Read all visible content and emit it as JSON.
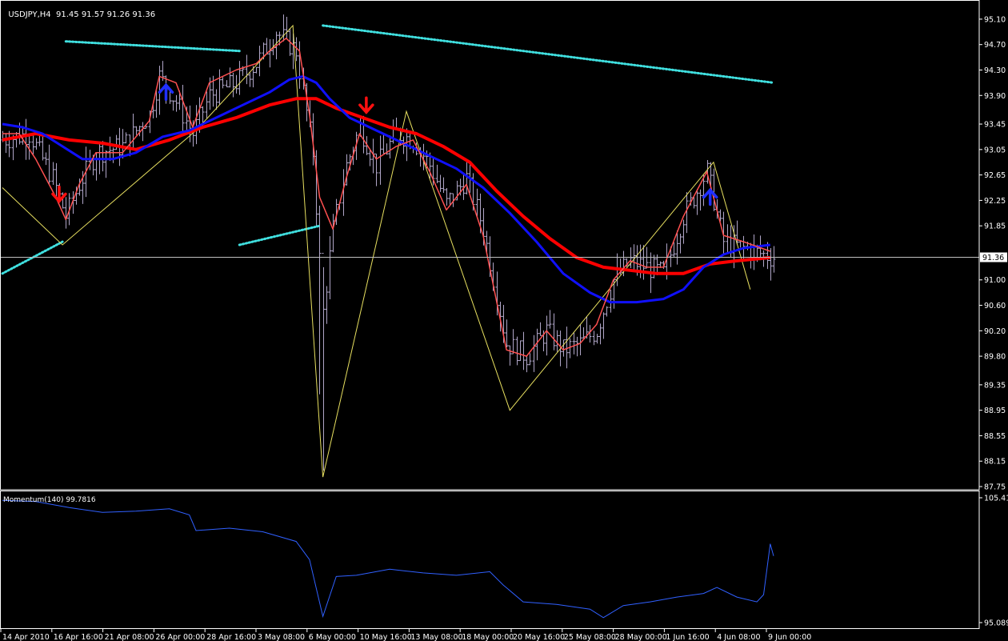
{
  "header": {
    "symbol": "USDJPY,H4",
    "ohlc": "91.45 91.57 91.26 91.36"
  },
  "indicator": {
    "label": "Momentum(140) 99.7816"
  },
  "colors": {
    "background": "#000000",
    "grid_axis": "#ffffff",
    "bar": "#b0a6c8",
    "ma_fast": "#ff5050",
    "ma_medium": "#1010ff",
    "ma_slow": "#ff0000",
    "zigzag": "#e8e060",
    "trend_dots": "#40e0e0",
    "arrow_up": "#2030ff",
    "arrow_down": "#ff1010",
    "momentum": "#3060ff",
    "price_tag_bg": "#ffffff",
    "price_tag_text": "#000000"
  },
  "chart_data": [
    {
      "type": "line",
      "title": "",
      "y_ticks": [
        "95.10",
        "94.70",
        "94.30",
        "93.90",
        "93.45",
        "93.05",
        "92.65",
        "92.25",
        "91.85",
        "91.00",
        "90.60",
        "90.20",
        "89.80",
        "89.35",
        "88.95",
        "88.55",
        "88.15",
        "87.75"
      ],
      "current_price_label": "91.36",
      "ylim": [
        87.7,
        95.25
      ],
      "x_ticks": [
        "14 Apr 2010",
        "16 Apr 16:00",
        "21 Apr 08:00",
        "26 Apr 00:00",
        "28 Apr 16:00",
        "3 May 08:00",
        "6 May 00:00",
        "10 May 16:00",
        "13 May 08:00",
        "18 May 00:00",
        "20 May 16:00",
        "25 May 08:00",
        "28 May 00:00",
        "1 Jun 16:00",
        "4 Jun 08:00",
        "9 Jun 00:00"
      ],
      "bar_count": 232,
      "series": [
        {
          "key": "close",
          "values": [
            [
              0,
              93.2
            ],
            [
              8,
              93.3
            ],
            [
              15,
              92.6
            ],
            [
              19,
              92.0
            ],
            [
              23,
              92.5
            ],
            [
              28,
              93.0
            ],
            [
              36,
              93.1
            ],
            [
              44,
              93.6
            ],
            [
              47,
              94.2
            ],
            [
              52,
              93.8
            ],
            [
              57,
              93.3
            ],
            [
              62,
              93.9
            ],
            [
              70,
              94.1
            ],
            [
              76,
              94.4
            ],
            [
              82,
              94.9
            ],
            [
              88,
              94.6
            ],
            [
              93,
              93.0
            ],
            [
              96,
              90.5
            ],
            [
              99,
              91.8
            ],
            [
              103,
              92.8
            ],
            [
              107,
              93.4
            ],
            [
              112,
              92.8
            ],
            [
              118,
              93.3
            ],
            [
              123,
              93.2
            ],
            [
              128,
              92.8
            ],
            [
              133,
              92.2
            ],
            [
              139,
              92.6
            ],
            [
              144,
              91.8
            ],
            [
              151,
              90.0
            ],
            [
              157,
              89.8
            ],
            [
              163,
              90.2
            ],
            [
              168,
              89.9
            ],
            [
              173,
              90.0
            ],
            [
              178,
              90.2
            ],
            [
              183,
              91.0
            ],
            [
              188,
              91.3
            ],
            [
              193,
              91.2
            ],
            [
              198,
              91.1
            ],
            [
              204,
              92.0
            ],
            [
              211,
              92.7
            ],
            [
              216,
              91.6
            ],
            [
              222,
              91.5
            ],
            [
              230,
              91.36
            ]
          ]
        },
        {
          "key": "ma_fast",
          "values": [
            [
              0,
              93.3
            ],
            [
              5,
              93.3
            ],
            [
              10,
              92.9
            ],
            [
              16,
              92.3
            ],
            [
              19,
              91.95
            ],
            [
              23,
              92.5
            ],
            [
              28,
              93.0
            ],
            [
              36,
              93.0
            ],
            [
              44,
              93.5
            ],
            [
              47,
              94.2
            ],
            [
              52,
              94.1
            ],
            [
              57,
              93.4
            ],
            [
              62,
              94.1
            ],
            [
              70,
              94.3
            ],
            [
              76,
              94.4
            ],
            [
              80,
              94.6
            ],
            [
              85,
              94.8
            ],
            [
              89,
              94.6
            ],
            [
              92,
              93.6
            ],
            [
              95,
              92.3
            ],
            [
              99,
              91.8
            ],
            [
              103,
              92.6
            ],
            [
              107,
              93.3
            ],
            [
              112,
              92.9
            ],
            [
              118,
              93.1
            ],
            [
              123,
              93.2
            ],
            [
              128,
              92.7
            ],
            [
              133,
              92.1
            ],
            [
              139,
              92.5
            ],
            [
              144,
              91.7
            ],
            [
              151,
              89.9
            ],
            [
              157,
              89.8
            ],
            [
              163,
              90.2
            ],
            [
              168,
              89.9
            ],
            [
              173,
              90.0
            ],
            [
              178,
              90.3
            ],
            [
              183,
              91.0
            ],
            [
              188,
              91.3
            ],
            [
              193,
              91.2
            ],
            [
              198,
              91.2
            ],
            [
              204,
              92.0
            ],
            [
              211,
              92.7
            ],
            [
              216,
              91.7
            ],
            [
              222,
              91.6
            ],
            [
              230,
              91.45
            ]
          ]
        },
        {
          "key": "ma_medium",
          "values": [
            [
              0,
              93.45
            ],
            [
              6,
              93.4
            ],
            [
              12,
              93.3
            ],
            [
              18,
              93.1
            ],
            [
              24,
              92.9
            ],
            [
              33,
              92.9
            ],
            [
              40,
              93.0
            ],
            [
              48,
              93.25
            ],
            [
              56,
              93.35
            ],
            [
              64,
              93.55
            ],
            [
              72,
              93.75
            ],
            [
              80,
              93.95
            ],
            [
              86,
              94.15
            ],
            [
              90,
              94.2
            ],
            [
              94,
              94.1
            ],
            [
              98,
              93.85
            ],
            [
              104,
              93.55
            ],
            [
              112,
              93.35
            ],
            [
              120,
              93.15
            ],
            [
              128,
              92.95
            ],
            [
              136,
              92.75
            ],
            [
              144,
              92.45
            ],
            [
              152,
              92.05
            ],
            [
              160,
              91.6
            ],
            [
              168,
              91.1
            ],
            [
              176,
              90.8
            ],
            [
              182,
              90.65
            ],
            [
              190,
              90.65
            ],
            [
              198,
              90.7
            ],
            [
              204,
              90.85
            ],
            [
              210,
              91.2
            ],
            [
              216,
              91.4
            ],
            [
              222,
              91.5
            ],
            [
              230,
              91.55
            ]
          ]
        },
        {
          "key": "ma_slow",
          "values": [
            [
              0,
              93.2
            ],
            [
              10,
              93.3
            ],
            [
              20,
              93.2
            ],
            [
              30,
              93.15
            ],
            [
              40,
              93.05
            ],
            [
              50,
              93.2
            ],
            [
              60,
              93.4
            ],
            [
              70,
              93.55
            ],
            [
              80,
              93.75
            ],
            [
              88,
              93.85
            ],
            [
              94,
              93.85
            ],
            [
              100,
              93.7
            ],
            [
              108,
              93.55
            ],
            [
              116,
              93.4
            ],
            [
              124,
              93.3
            ],
            [
              132,
              93.1
            ],
            [
              140,
              92.85
            ],
            [
              148,
              92.4
            ],
            [
              156,
              92.0
            ],
            [
              164,
              91.65
            ],
            [
              172,
              91.35
            ],
            [
              180,
              91.2
            ],
            [
              188,
              91.15
            ],
            [
              196,
              91.1
            ],
            [
              204,
              91.1
            ],
            [
              212,
              91.25
            ],
            [
              220,
              91.3
            ],
            [
              230,
              91.35
            ]
          ]
        },
        {
          "key": "zigzag",
          "values": [
            [
              0,
              92.45
            ],
            [
              18,
              91.55
            ],
            [
              58,
              93.35
            ],
            [
              87,
              95.0
            ],
            [
              96,
              87.9
            ],
            [
              121,
              93.65
            ],
            [
              152,
              88.95
            ],
            [
              213,
              92.85
            ],
            [
              224,
              90.85
            ]
          ]
        },
        {
          "key": "trendlines",
          "values": [
            [
              [
                0,
                91.1
              ],
              [
                18,
                91.6
              ]
            ],
            [
              [
                19,
                94.75
              ],
              [
                71,
                94.6
              ]
            ],
            [
              [
                96,
                95.0
              ],
              [
                231,
                94.1
              ]
            ],
            [
              [
                71,
                91.55
              ],
              [
                95,
                91.85
              ]
            ]
          ]
        },
        {
          "key": "arrows",
          "values": [
            {
              "type": "down",
              "x": 17,
              "y": 92.35
            },
            {
              "type": "up",
              "x": 49,
              "y": 93.95
            },
            {
              "type": "down",
              "x": 109,
              "y": 93.75
            },
            {
              "type": "up",
              "x": 212,
              "y": 92.3
            }
          ]
        }
      ]
    },
    {
      "type": "line",
      "title": "Momentum(140) 99.7816",
      "y_ticks": [
        "105.413",
        "95.0892"
      ],
      "ylim": [
        95.0892,
        105.413
      ],
      "series": [
        {
          "key": "momentum",
          "values": [
            [
              0,
              105.2
            ],
            [
              10,
              105.1
            ],
            [
              20,
              104.6
            ],
            [
              30,
              104.2
            ],
            [
              40,
              104.3
            ],
            [
              50,
              104.5
            ],
            [
              56,
              104.0
            ],
            [
              58,
              102.7
            ],
            [
              68,
              102.9
            ],
            [
              78,
              102.6
            ],
            [
              88,
              101.8
            ],
            [
              92,
              100.3
            ],
            [
              96,
              95.6
            ],
            [
              100,
              98.9
            ],
            [
              106,
              99.0
            ],
            [
              116,
              99.5
            ],
            [
              126,
              99.2
            ],
            [
              136,
              99.0
            ],
            [
              146,
              99.3
            ],
            [
              150,
              98.2
            ],
            [
              156,
              96.8
            ],
            [
              166,
              96.6
            ],
            [
              176,
              96.2
            ],
            [
              180,
              95.5
            ],
            [
              186,
              96.5
            ],
            [
              194,
              96.8
            ],
            [
              202,
              97.2
            ],
            [
              210,
              97.5
            ],
            [
              214,
              98.0
            ],
            [
              220,
              97.2
            ],
            [
              226,
              96.8
            ],
            [
              228,
              97.4
            ],
            [
              230,
              101.6
            ],
            [
              231,
              100.6
            ]
          ]
        }
      ]
    }
  ]
}
